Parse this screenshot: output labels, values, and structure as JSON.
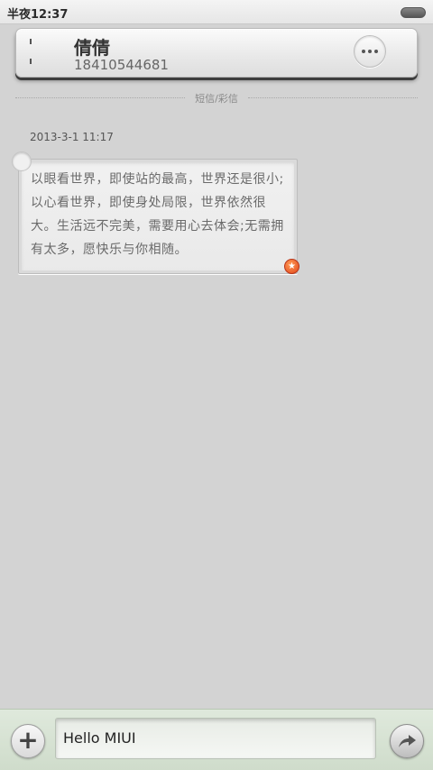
{
  "status_bar": {
    "time": "半夜12:37"
  },
  "contact": {
    "name": "倩倩",
    "number": "18410544681"
  },
  "divider": {
    "label": "短信/彩信"
  },
  "message": {
    "timestamp": "2013-3-1 11:17",
    "text": "以眼看世界，即使站的最高，世界还是很小;以心看世界，即使身处局限，世界依然很大。生活远不完美，需要用心去体会;无需拥有太多，愿快乐与你相随。"
  },
  "compose": {
    "input_value": "Hello MIUI"
  },
  "icons": {
    "battery": "battery-icon",
    "more": "more-icon",
    "add": "plus-icon",
    "send": "send-arrow-icon",
    "star": "star-badge-icon"
  },
  "colors": {
    "background": "#d3d3d3",
    "compose_bar": "#d8e4d4",
    "badge": "#e2461a"
  }
}
